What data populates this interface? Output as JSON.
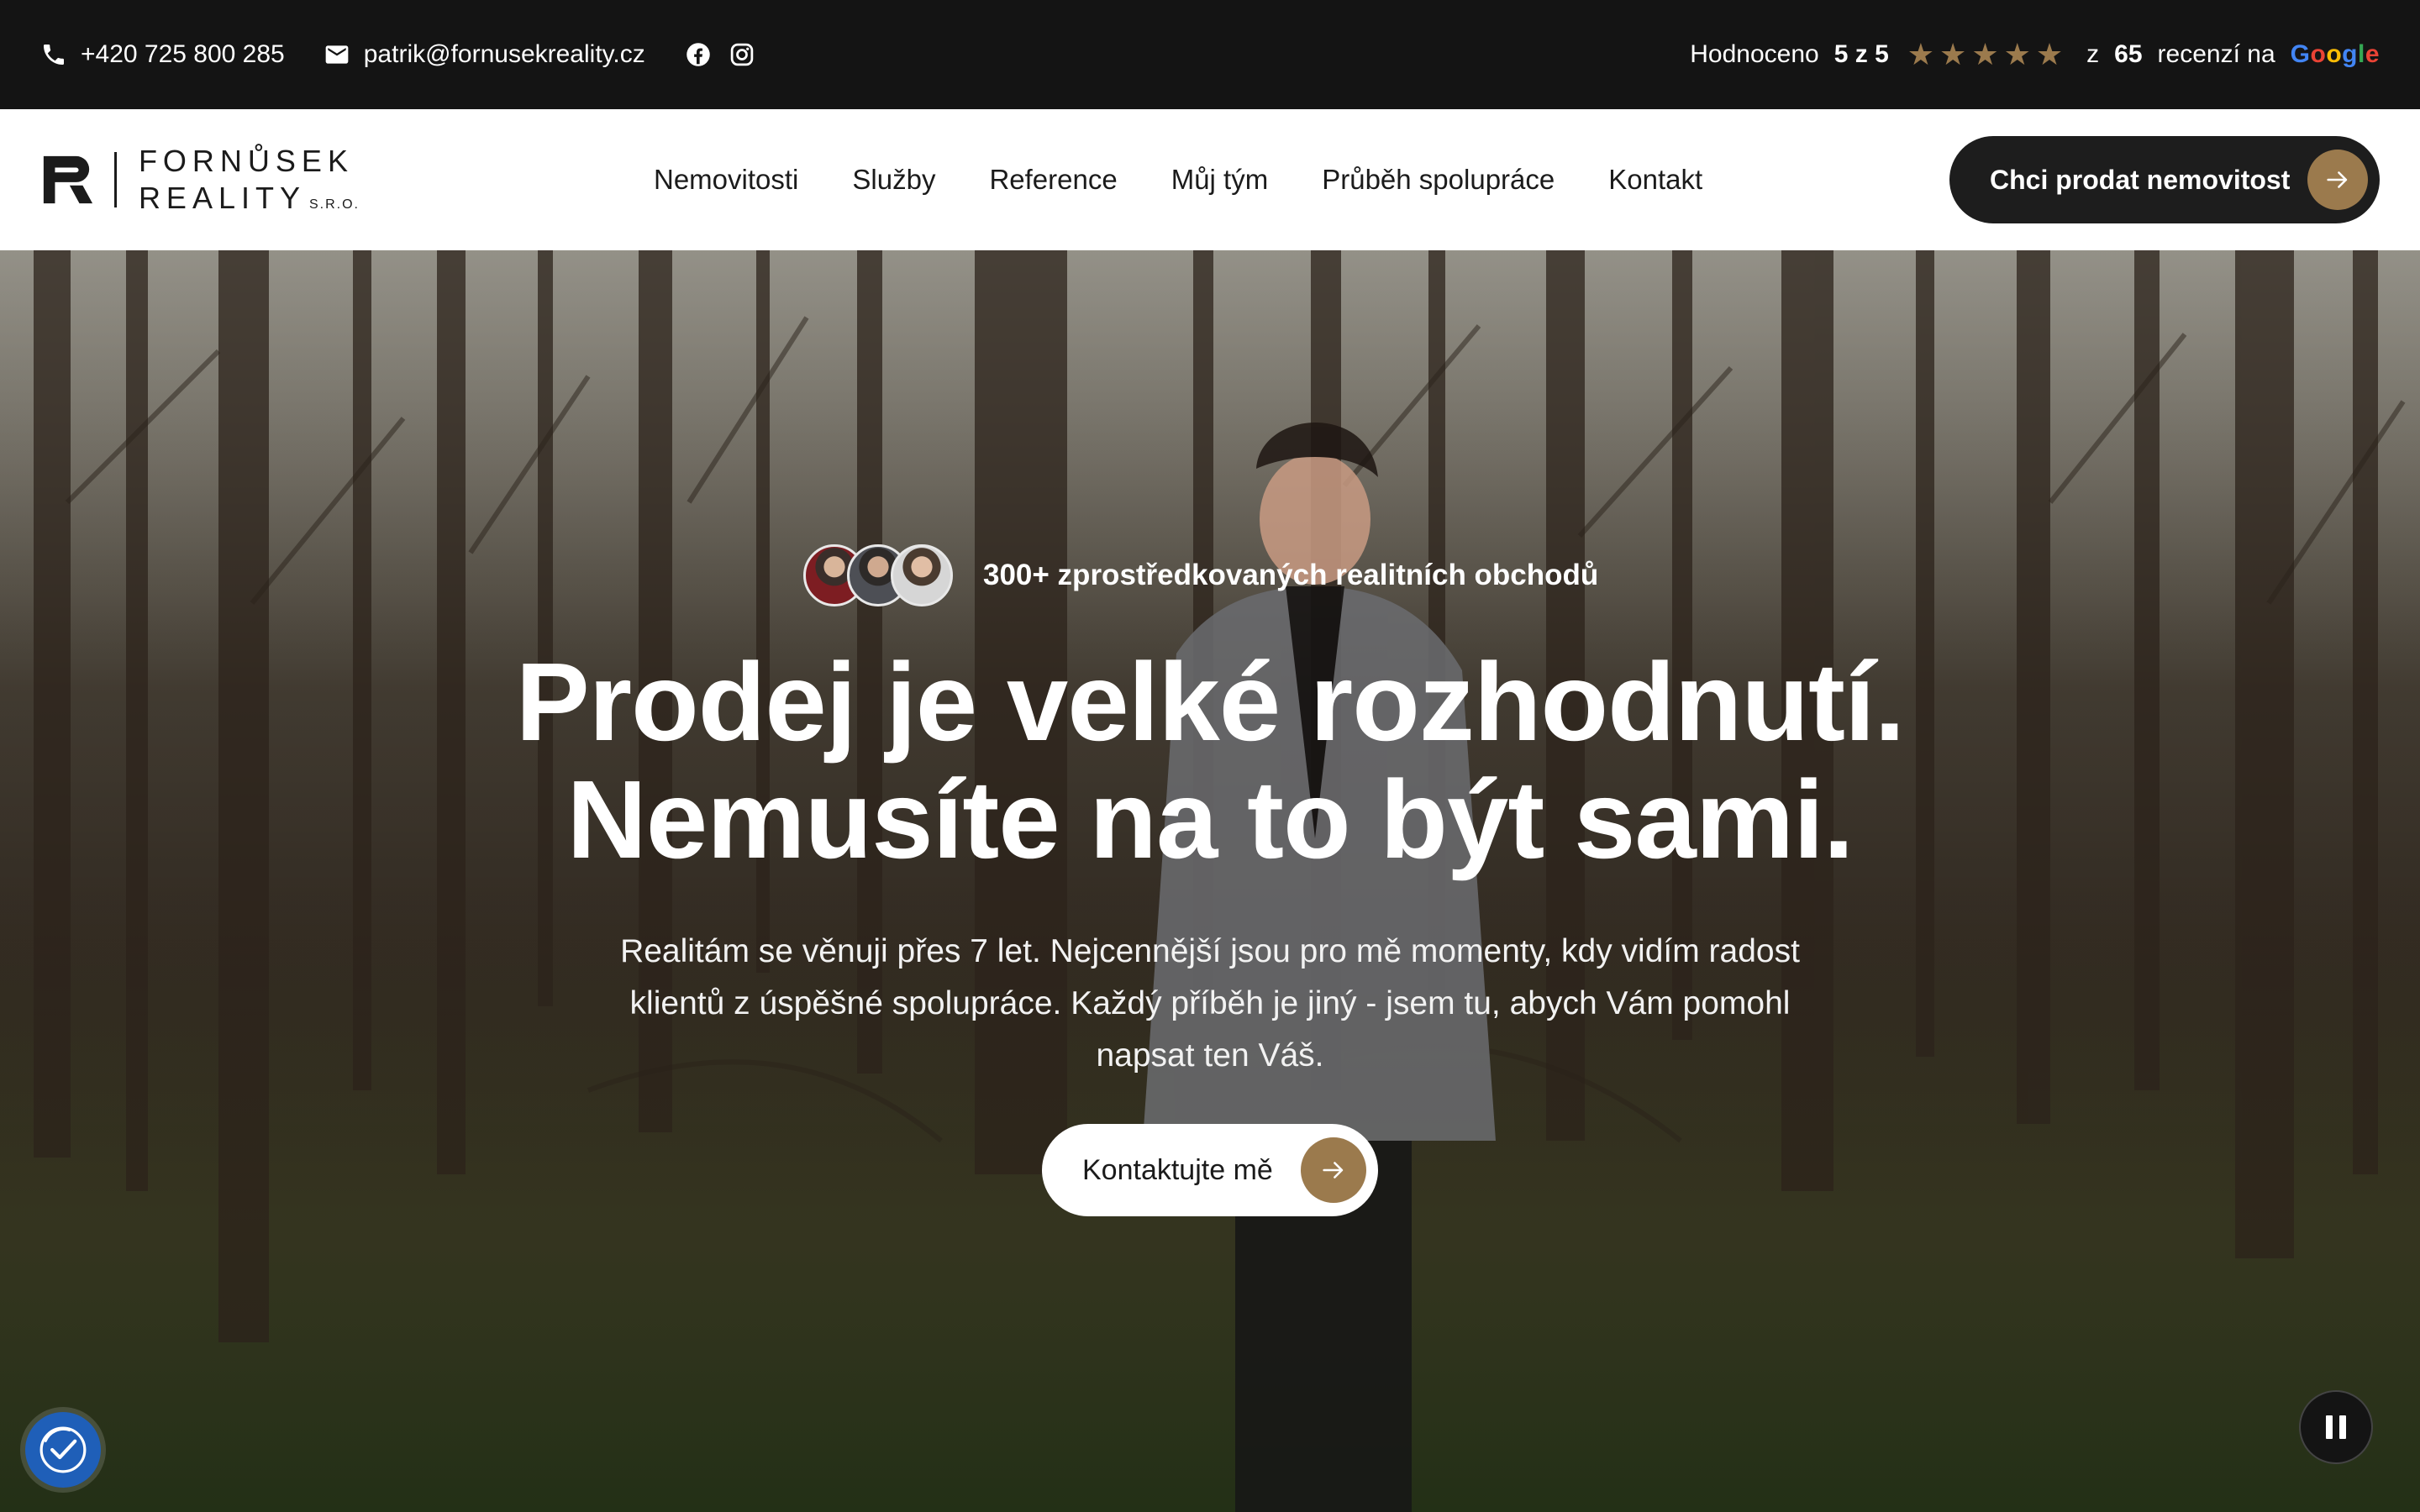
{
  "topbar": {
    "phone": "+420 725 800 285",
    "email": "patrik@fornusekreality.cz",
    "socials": [
      "facebook-icon",
      "instagram-icon"
    ],
    "rating_prefix": "Hodnoceno",
    "rating_value": "5 z 5",
    "stars": 5,
    "reviews_prefix": "z",
    "reviews_count": "65",
    "reviews_suffix": "recenzí na",
    "google_letters": [
      "G",
      "o",
      "o",
      "g",
      "l",
      "e"
    ]
  },
  "nav": {
    "logo_line1": "FORNŮSEK",
    "logo_line2": "REALITY",
    "logo_suffix": "S.R.O.",
    "links": [
      "Nemovitosti",
      "Služby",
      "Reference",
      "Můj tým",
      "Průběh spolupráce",
      "Kontakt"
    ],
    "cta_label": "Chci prodat nemovitost"
  },
  "hero": {
    "badge_text": "300+ zprostředkovaných realitních obchodů",
    "headline_line1": "Prodej je velké rozhodnutí.",
    "headline_line2": "Nemusíte na to být sami.",
    "subtext": "Realitám se věnuji přes 7 let. Nejcennější jsou pro mě momenty, kdy vidím radost klientů z úspěšné spolupráce. Každý příběh je jiný - jsem tu, abych Vám pomohl napsat ten Váš.",
    "cta_label": "Kontaktujte mě"
  },
  "colors": {
    "accent": "#9b7a4d",
    "dark": "#141414",
    "a11y": "#1f5fb8"
  }
}
